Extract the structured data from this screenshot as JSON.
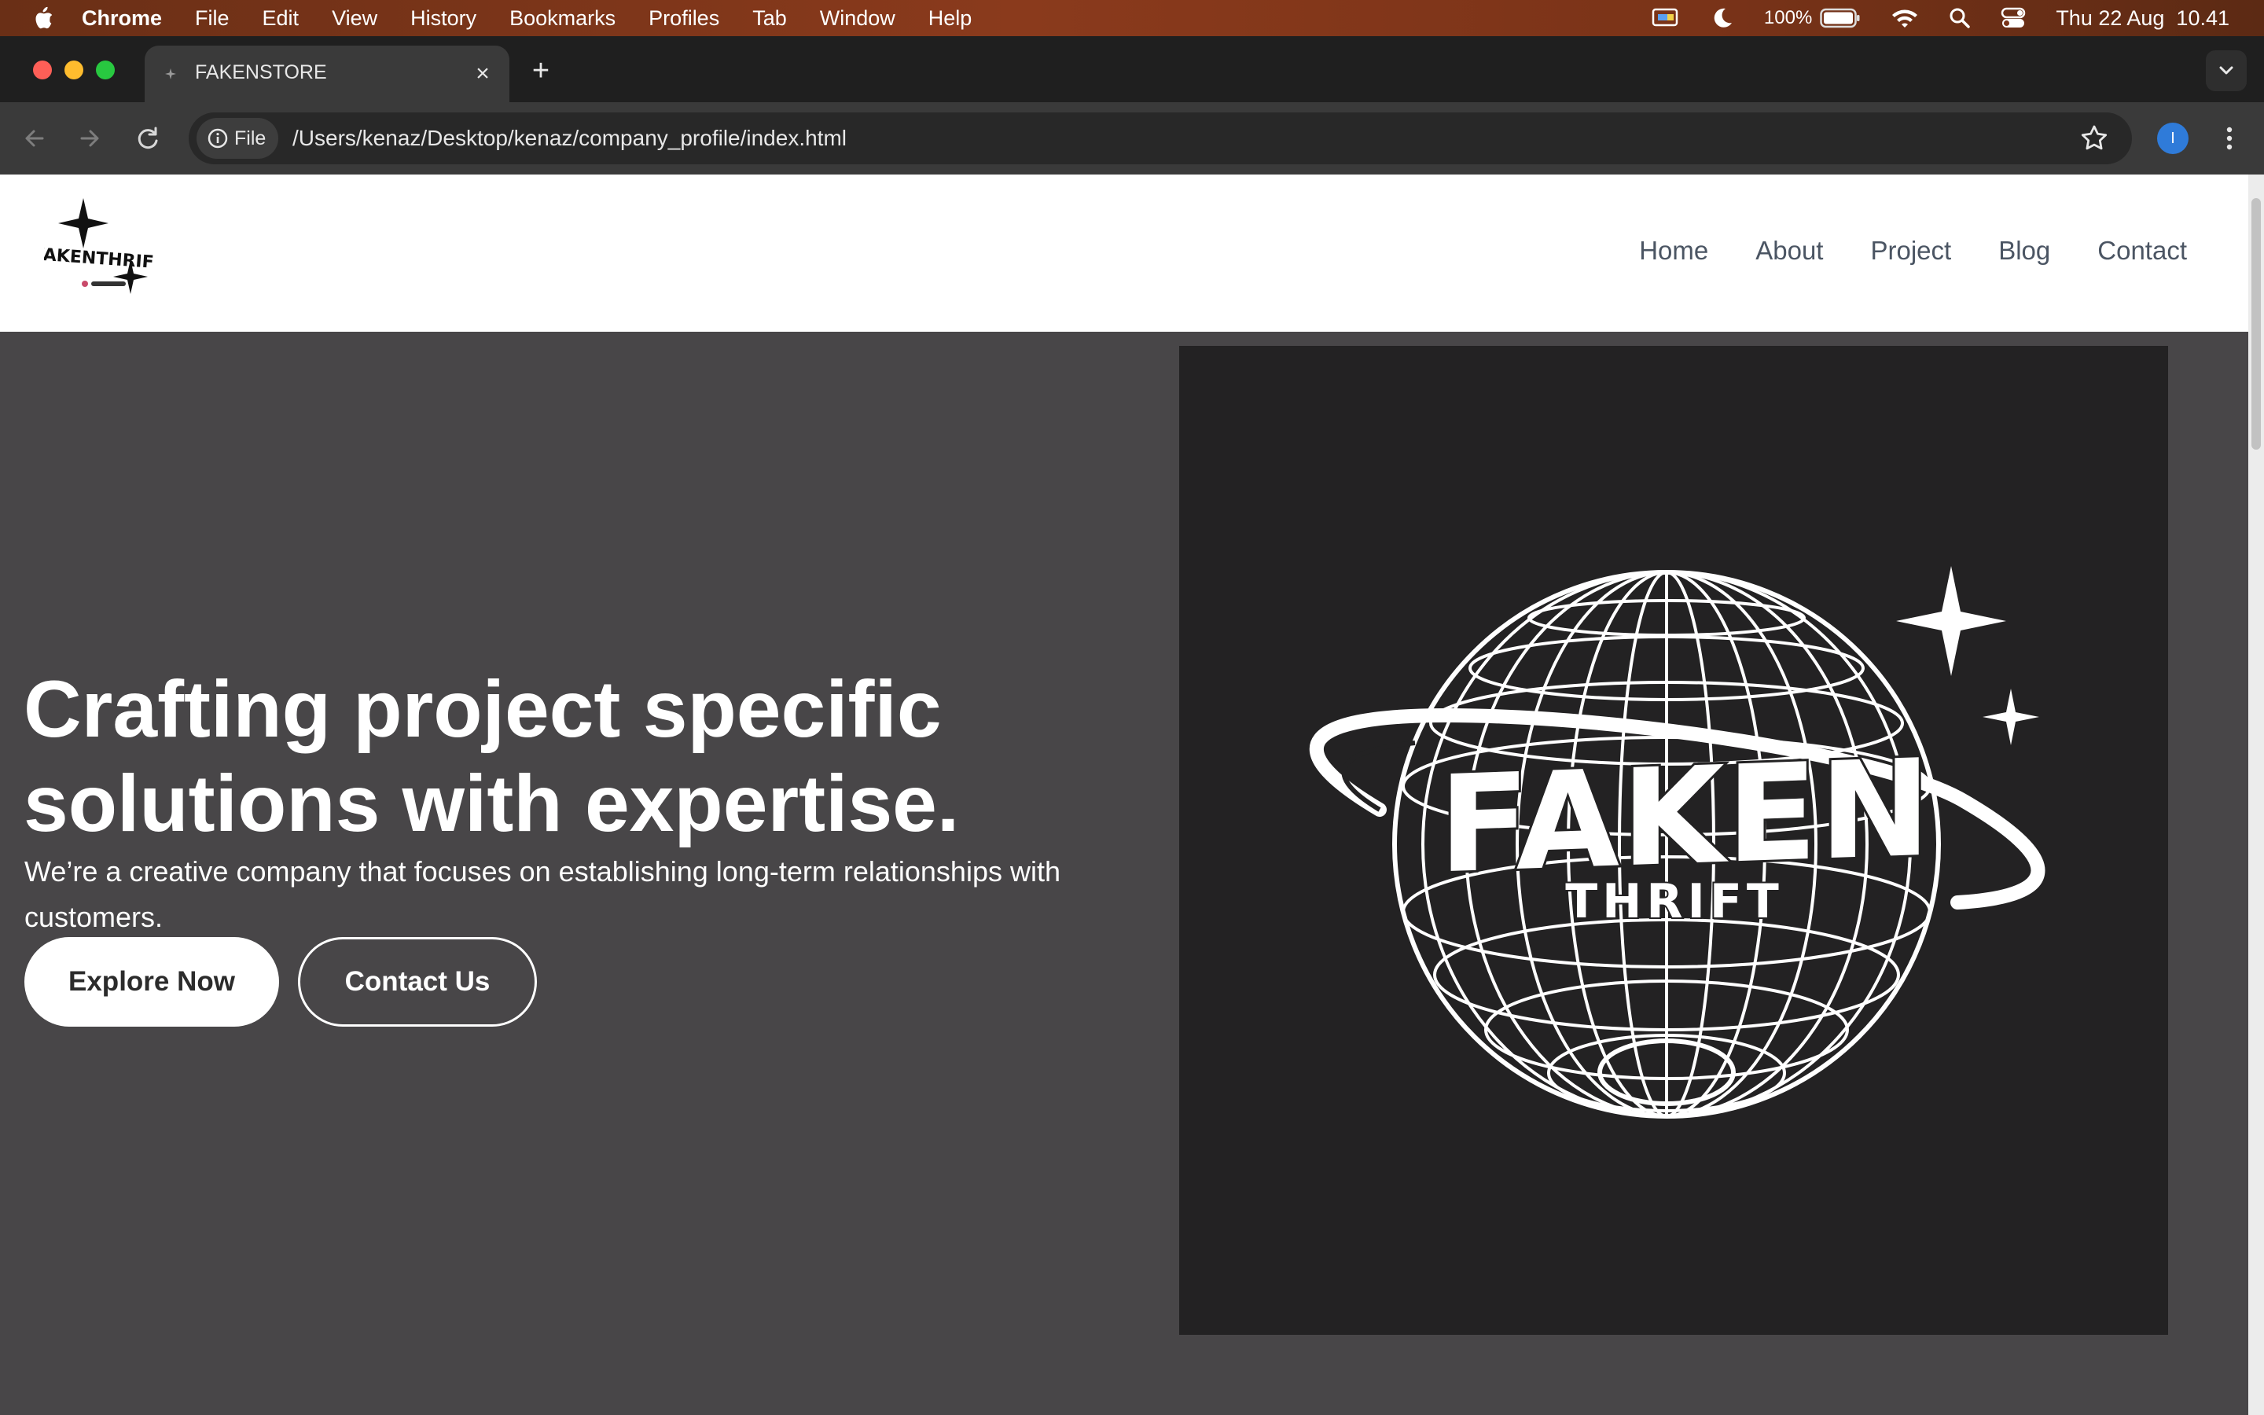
{
  "menubar": {
    "app": "Chrome",
    "items": [
      "File",
      "Edit",
      "View",
      "History",
      "Bookmarks",
      "Profiles",
      "Tab",
      "Window",
      "Help"
    ],
    "battery": "100%",
    "clock": "Thu 22 Aug  10.41",
    "icons": [
      "input-source-icon",
      "do-not-disturb-moon-icon",
      "battery-icon",
      "wifi-icon",
      "spotlight-search-icon",
      "control-center-icon"
    ]
  },
  "browser": {
    "tab_title": "FAKENSTORE",
    "file_chip": "File",
    "url": "/Users/kenaz/Desktop/kenaz/company_profile/index.html",
    "profile_initial": "I"
  },
  "site": {
    "logo_text": "FAKENTHRIFT",
    "nav": [
      "Home",
      "About",
      "Project",
      "Blog",
      "Contact"
    ],
    "hero_title": "Crafting project specific solutions with expertise.",
    "hero_subtitle": "We’re a creative company that focuses on establishing long-term relationships with customers.",
    "primary_button": "Explore Now",
    "secondary_button": "Contact Us",
    "hero_brand_word": "FAKEN",
    "hero_brand_sub": "THRIFT"
  },
  "colors": {
    "hero_background": "#484648",
    "image_background": "#232223",
    "nav_text": "#4b5563"
  }
}
